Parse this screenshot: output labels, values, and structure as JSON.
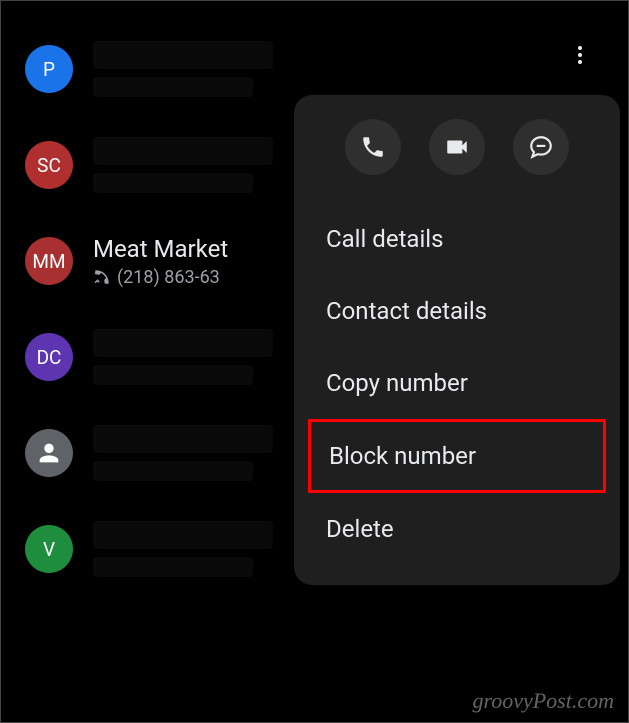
{
  "calls": [
    {
      "initials": "P",
      "avatarClass": "avatar-blue",
      "name": "",
      "detail": "",
      "redacted": true
    },
    {
      "initials": "SC",
      "avatarClass": "avatar-red",
      "name": "",
      "detail": "",
      "redacted": true
    },
    {
      "initials": "MM",
      "avatarClass": "avatar-darkred",
      "name": "Meat Market",
      "detail": "(218) 863-63",
      "redacted": false
    },
    {
      "initials": "DC",
      "avatarClass": "avatar-purple",
      "name": "",
      "detail": "",
      "redacted": true
    },
    {
      "initials": "",
      "avatarClass": "avatar-gray",
      "name": "",
      "detail": "",
      "redacted": true,
      "iconAvatar": true
    },
    {
      "initials": "V",
      "avatarClass": "avatar-green",
      "name": "",
      "detail": "",
      "redacted": true
    }
  ],
  "menu": {
    "callDetails": "Call details",
    "contactDetails": "Contact details",
    "copyNumber": "Copy number",
    "blockNumber": "Block number",
    "delete": "Delete"
  },
  "watermark": "groovyPost.com"
}
